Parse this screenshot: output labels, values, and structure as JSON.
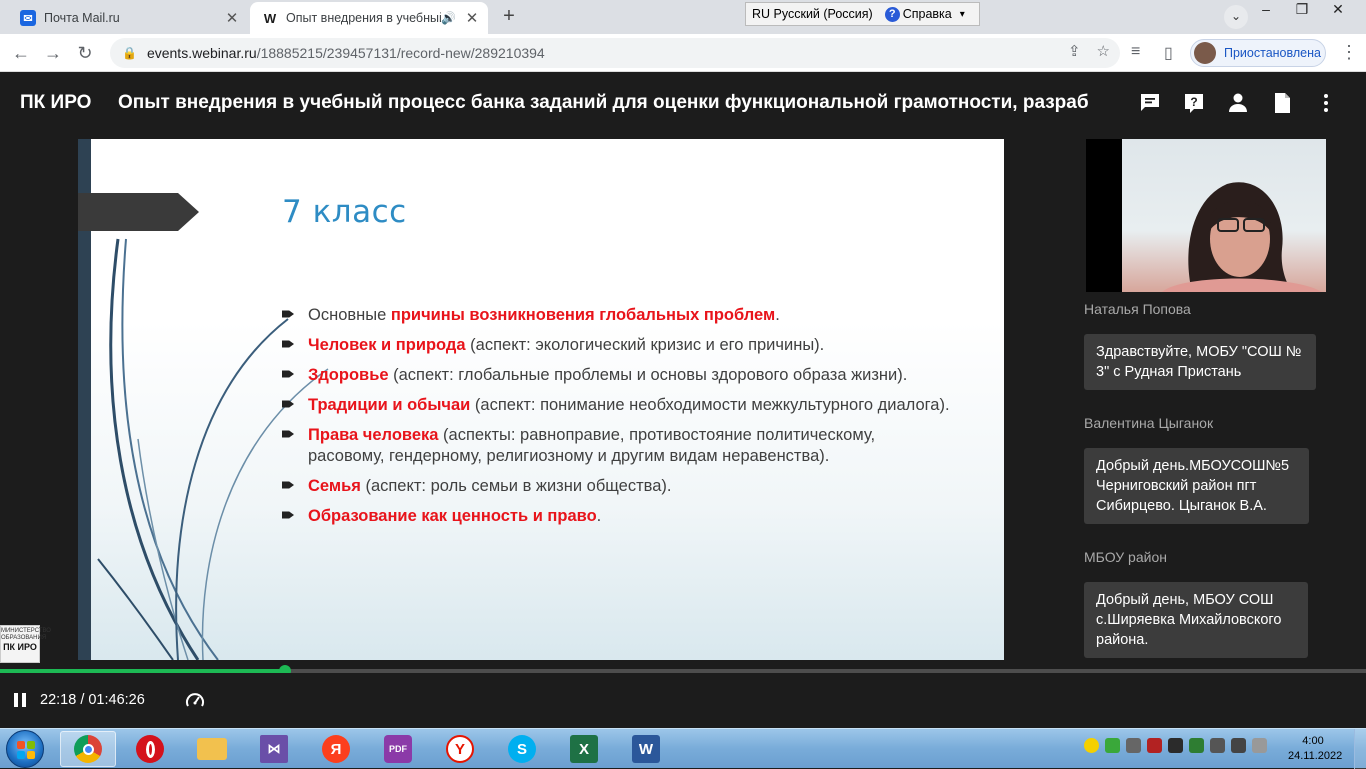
{
  "browser": {
    "tabs": [
      {
        "title": "Почта Mail.ru",
        "favicon_letter": "✉",
        "favicon_color": "#1a66e0"
      },
      {
        "title": "Опыт внедрения в учебный",
        "favicon_letter": "W",
        "favicon_color": "#1c1c1c"
      }
    ],
    "lang_bar": {
      "lang": "RU Русский (Россия)",
      "help": "Справка"
    },
    "url_host": "events.webinar.ru",
    "url_path": "/18885215/239457131/record-new/289210394",
    "profile_status": "Приостановлена"
  },
  "webinar": {
    "org": "ПК ИРО",
    "title": "Опыт внедрения в учебный процесс банка заданий для оценки функциональной грамотности, разраб"
  },
  "slide": {
    "title": "7 класс",
    "bullets": [
      {
        "pre": "Основные ",
        "hl": "причины возникновения глобальных проблем",
        "post": "."
      },
      {
        "pre": " ",
        "hl": "Человек и природа",
        "post": " (аспект: экологический кризис и его причины)."
      },
      {
        "pre": "",
        "hl": "Здоровье",
        "post": " (аспект: глобальные проблемы и основы здорового образа жизни)."
      },
      {
        "pre": "",
        "hl": "Традиции и обычаи",
        "post": " (аспект: понимание необходимости межкультурного диалога)."
      },
      {
        "pre": "",
        "hl": "Права человека",
        "post": " (аспекты: равноправие, противостояние политическому, расовому, гендерному, религиозному и другим видам неравенства)."
      },
      {
        "pre": "",
        "hl": "Семья",
        "post": " (аспект: роль семьи в жизни общества)."
      },
      {
        "pre": "",
        "hl": "Образование как ценность и право",
        "post": "."
      }
    ]
  },
  "presenter": {
    "name": "Наталья Попова"
  },
  "chat": [
    {
      "author": "",
      "text": "Здравствуйте, МОБУ \"СОШ № 3\" с Рудная Пристань"
    },
    {
      "author": "Валентина Цыганок",
      "text": "Добрый день.МБОУСОШ№5 Черниговский район пгт Сибирцево. Цыганок В.А."
    },
    {
      "author": "МБОУ район",
      "text": "Добрый день, МБОУ СОШ с.Ширяевка Михайловского района."
    }
  ],
  "player": {
    "current_time": "22:18",
    "total_time": "01:46:26",
    "time_display": "22:18 / 01:46:26",
    "progress_fraction": 0.209,
    "accent": "#1db954"
  },
  "corner_logo": {
    "small": "МИНИСТЕРСТВО ОБРАЗОВАНИЯ",
    "big": "ПК ИРО"
  },
  "taskbar": {
    "apps": [
      "chrome-icon",
      "opera-icon",
      "explorer-icon",
      "visual-studio-icon",
      "yandex-icon",
      "pdf-icon",
      "yandex-browser-icon",
      "skype-icon",
      "excel-icon",
      "word-icon"
    ],
    "clock_time": "4:00",
    "clock_date": "24.11.2022"
  }
}
